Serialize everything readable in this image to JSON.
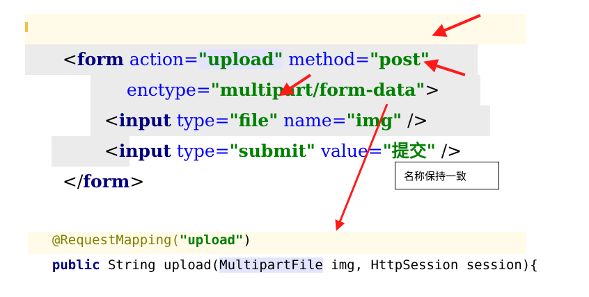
{
  "html_snippet": {
    "line1": {
      "open": "<",
      "tag": "form",
      "attr1": " action=",
      "val1": "\"upload\"",
      "attr2": " method=",
      "val2": "\"post\""
    },
    "line2": {
      "attr": "enctype=",
      "val": "\"multipart/form-data\"",
      "close": ">"
    },
    "line3": {
      "open": "<",
      "tag": "input",
      "attr1": " type=",
      "val1": "\"file\"",
      "attr2": " name=",
      "val2": "\"img\"",
      "close": " />"
    },
    "line4": {
      "open": "<",
      "tag": "input",
      "attr1": " type=",
      "val1": "\"submit\"",
      "attr2": " value=",
      "val2": "\"提交\"",
      "close": " />"
    },
    "line5": {
      "open": "</",
      "tag": "form",
      "close": ">"
    }
  },
  "java_snippet": {
    "annotation_name": "@RequestMapping(",
    "annotation_value": "\"upload\"",
    "annotation_close": ")",
    "keyword": "public",
    "return_type": " String upload(",
    "param_type": "MultipartFile",
    "params_rest": " img, HttpSession session){"
  },
  "callout": {
    "text": "名称保持一致"
  },
  "colors": {
    "arrow": "#ff1a1a",
    "tag": "#000080",
    "attribute": "#0000ff",
    "string": "#008000",
    "line_highlight": "#fffbe8",
    "selection": "#e8e8e8"
  }
}
